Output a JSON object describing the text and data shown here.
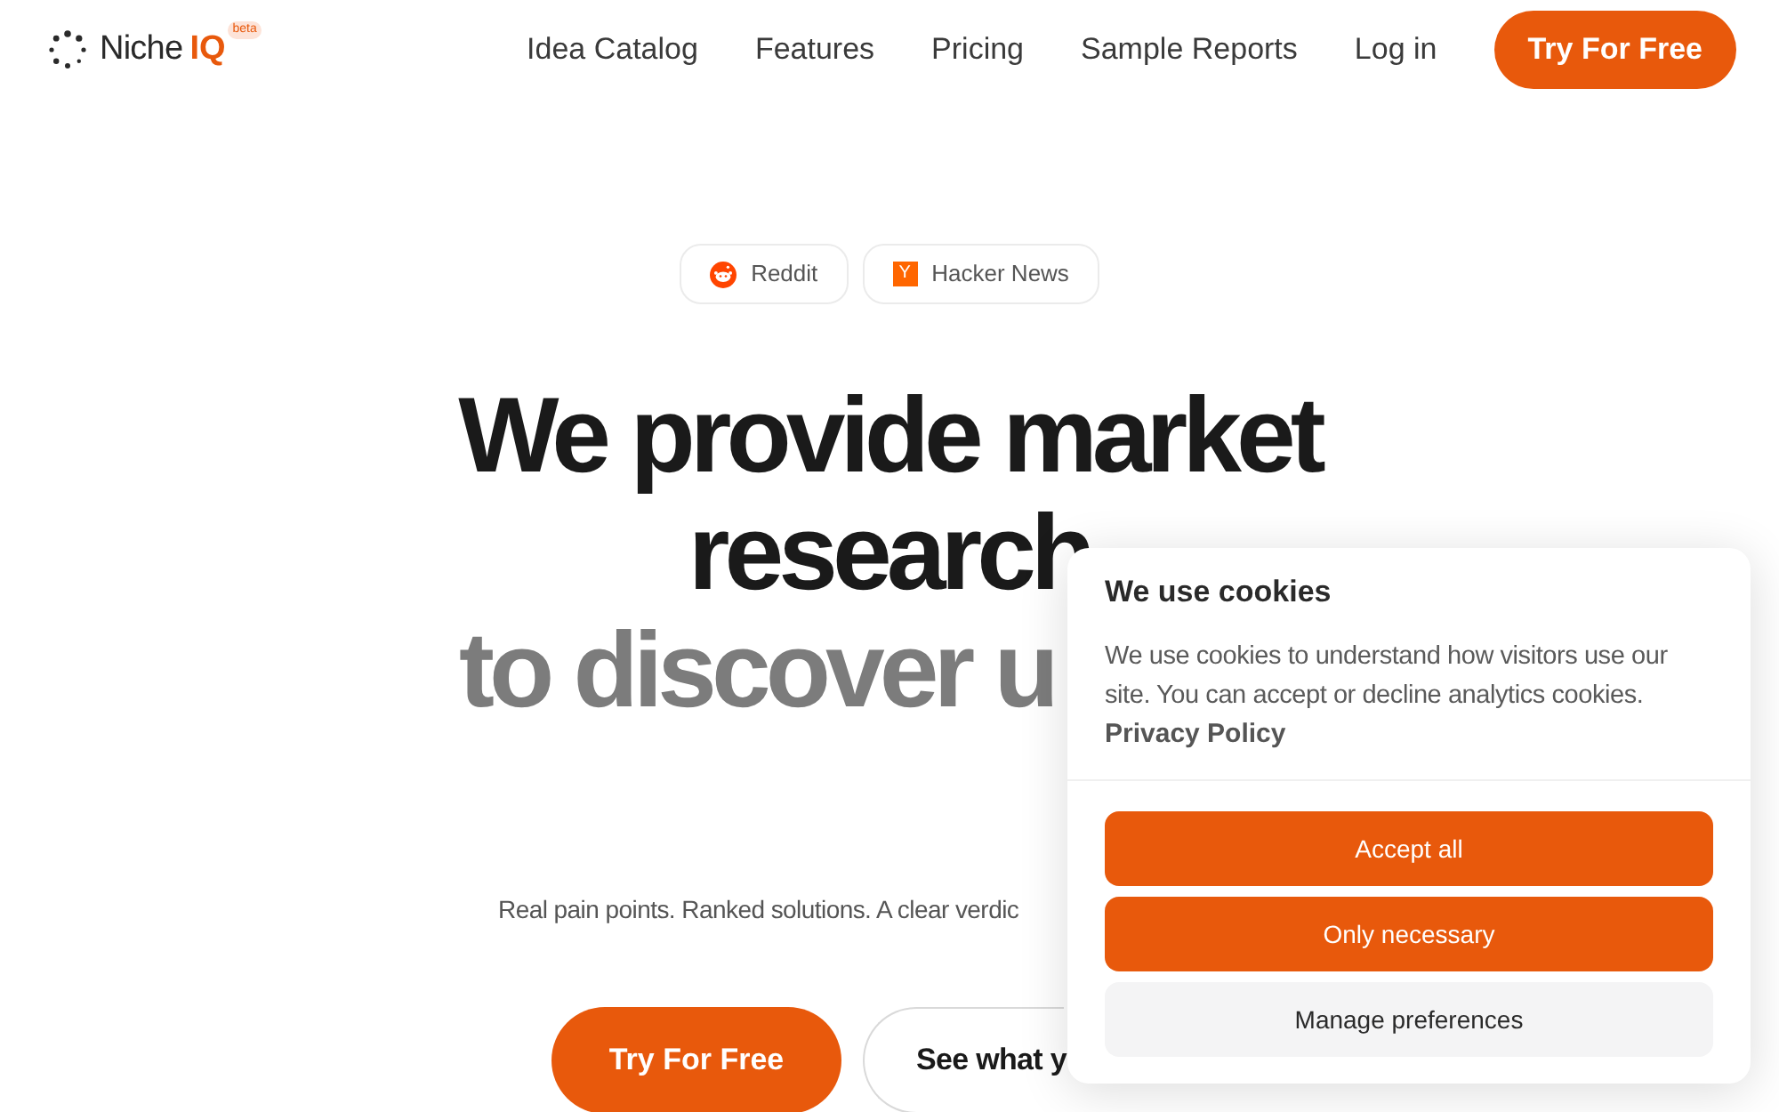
{
  "nav": {
    "brand": {
      "name": "Niche",
      "accent": "IQ",
      "badge": "beta"
    },
    "links": [
      "Idea Catalog",
      "Features",
      "Pricing",
      "Sample Reports",
      "Log in"
    ],
    "cta": "Try For Free"
  },
  "hero": {
    "sources": [
      {
        "kind": "reddit",
        "label": "Reddit"
      },
      {
        "kind": "letter",
        "glyph": "Y",
        "label": "Hacker News"
      }
    ],
    "headline": [
      "We provide market",
      "research"
    ],
    "headline_muted": "to discover u",
    "subtitle": "Real pain points. Ranked solutions. A clear verdic",
    "buttons": [
      {
        "kind": "primary",
        "label": "Try For Free"
      },
      {
        "kind": "outline",
        "label": "See what y"
      }
    ]
  },
  "cookie_banner": {
    "title": "We use cookies",
    "text": "We use cookies to understand how visitors use our site. You can accept or decline analytics cookies.",
    "link": "Privacy Policy",
    "buttons": [
      {
        "kind": "primary",
        "label": "Accept all"
      },
      {
        "kind": "primary",
        "label": "Only necessary"
      },
      {
        "kind": "secondary",
        "label": "Manage preferences"
      }
    ]
  }
}
